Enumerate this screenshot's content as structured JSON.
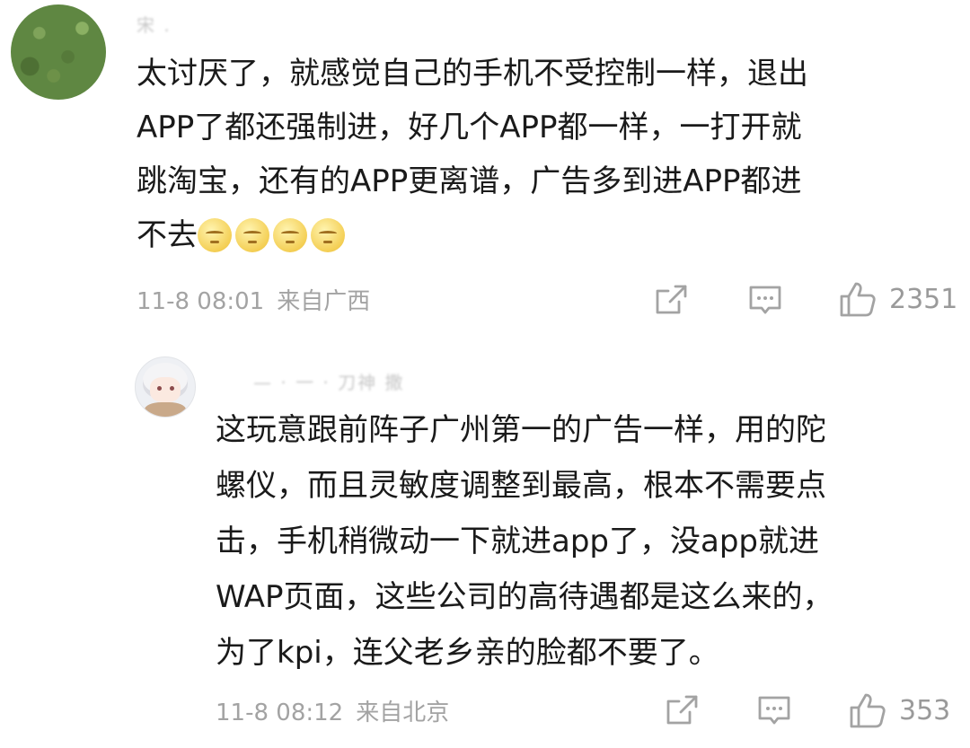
{
  "comments": [
    {
      "username": "宋 .",
      "lines": [
        "太讨厌了，就感觉自己的手机不受控制一样，退出",
        "APP了都还强制进，好几个APP都一样，一打开就",
        "跳淘宝，还有的APP更离谱，广告多到进APP都进",
        "不去"
      ],
      "emoji_count": 4,
      "emoji_name": "silent-face-emoji",
      "date": "11-8 08:01",
      "location": "来自广西",
      "likes": "2351"
    },
    {
      "username": "— · 一 · 刀神 撒",
      "lines": [
        "这玩意跟前阵子广州第一的广告一样，用的陀",
        "螺仪，而且灵敏度调整到最高，根本不需要点",
        "击，手机稍微动一下就进app了，没app就进",
        "WAP页面，这些公司的高待遇都是这么来的，",
        "为了kpi，连父老乡亲的脸都不要了。"
      ],
      "date": "11-8 08:12",
      "location": "来自北京",
      "likes": "353"
    }
  ],
  "icons": {
    "share": "share-icon",
    "comment": "comment-icon",
    "like": "thumbs-up-icon"
  },
  "colors": {
    "text": "#1a1a1a",
    "meta": "#a3a3a3",
    "background": "#ffffff"
  }
}
